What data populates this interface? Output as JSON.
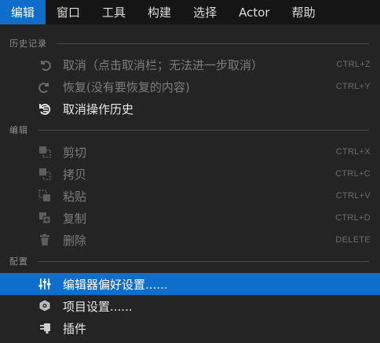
{
  "menubar": {
    "items": [
      "编辑",
      "窗口",
      "工具",
      "构建",
      "选择",
      "Actor",
      "帮助"
    ]
  },
  "sections": {
    "history": "历史记录",
    "edit": "编辑",
    "config": "配置"
  },
  "history_items": [
    {
      "label": "取消（点击取消栏；无法进一步取消）",
      "shortcut": "CTRL+Z",
      "icon": "undo-icon",
      "enabled": false
    },
    {
      "label": "恢复(没有要恢复的内容)",
      "shortcut": "CTRL+Y",
      "icon": "redo-icon",
      "enabled": false
    },
    {
      "label": "取消操作历史",
      "shortcut": "",
      "icon": "history-icon",
      "enabled": true
    }
  ],
  "edit_items": [
    {
      "label": "剪切",
      "shortcut": "CTRL+X",
      "icon": "cut-icon",
      "enabled": false
    },
    {
      "label": "拷贝",
      "shortcut": "CTRL+C",
      "icon": "copy-icon",
      "enabled": false
    },
    {
      "label": "粘贴",
      "shortcut": "CTRL+V",
      "icon": "paste-icon",
      "enabled": false
    },
    {
      "label": "复制",
      "shortcut": "CTRL+D",
      "icon": "duplicate-icon",
      "enabled": false
    },
    {
      "label": "删除",
      "shortcut": "DELETE",
      "icon": "delete-icon",
      "enabled": false
    }
  ],
  "config_items": [
    {
      "label": "编辑器偏好设置......",
      "shortcut": "",
      "icon": "sliders-icon",
      "highlighted": true
    },
    {
      "label": "项目设置......",
      "shortcut": "",
      "icon": "project-settings-icon",
      "highlighted": false
    },
    {
      "label": "插件",
      "shortcut": "",
      "icon": "plugin-icon",
      "highlighted": false
    }
  ],
  "colors": {
    "accent": "#0f6ec9",
    "menubar_bg": "#151515",
    "panel_bg": "#242424",
    "disabled_text": "#7d7d7d",
    "enabled_text": "#e8e8e8"
  }
}
